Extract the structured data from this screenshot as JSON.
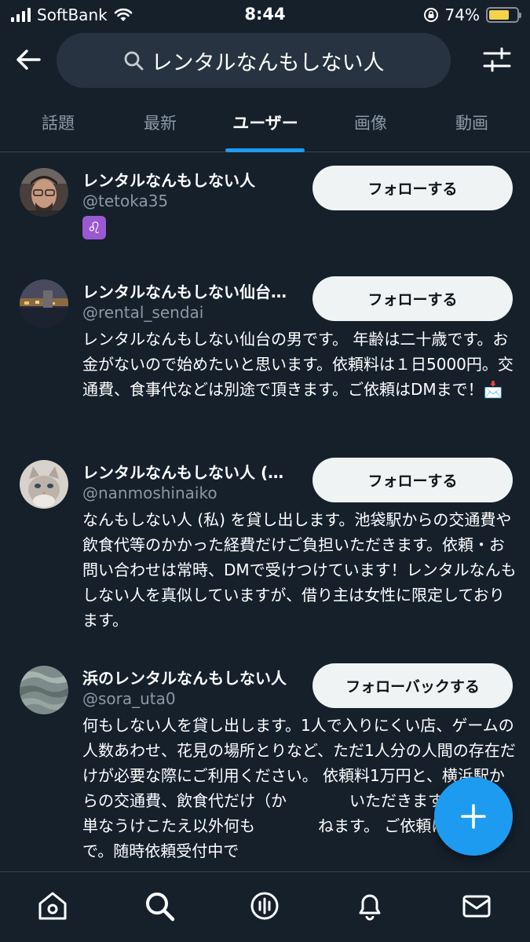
{
  "status_bar": {
    "carrier": "SoftBank",
    "time": "8:44",
    "battery": "74%",
    "battery_level": 0.74
  },
  "search": {
    "query": "レンタルなんもしない人"
  },
  "tabs": [
    {
      "label": "話題"
    },
    {
      "label": "最新"
    },
    {
      "label": "ユーザー"
    },
    {
      "label": "画像"
    },
    {
      "label": "動画"
    }
  ],
  "active_tab": "ユーザー",
  "users": [
    {
      "name": "レンタルなんもしない人",
      "handle": "@tetoka35",
      "bio": "♌",
      "button": "フォローする"
    },
    {
      "name": "レンタルなんもしない仙台…",
      "handle": "@rental_sendai",
      "bio": "レンタルなんもしない仙台の男です。 年齢は二十歳です。お金がないので始めたいと思います。依頼料は１日5000円。交通費、食事代などは別途で頂きます。ご依頼はDMまで！📩",
      "button": "フォローする"
    },
    {
      "name": "レンタルなんもしない人 (…",
      "handle": "@nanmoshinaiko",
      "bio": "なんもしない人 (私) を貸し出します。池袋駅からの交通費や飲食代等のかかった経費だけご負担いただきます。依頼・お問い合わせは常時、DMで受けつけています！レンタルなんもしない人を真似していますが、借り主は女性に限定しております。",
      "button": "フォローする"
    },
    {
      "name": "浜のレンタルなんもしない人",
      "handle": "@sora_uta0",
      "bio": "何もしない人を貸し出します。1人で入りにくい店、ゲームの人数あわせ、花見の場所とりなど、ただ1人分の人間の存在だけが必要な際にご利用ください。 依頼料1万円と、横浜駅からの交通費、飲食代だけ（か　　　　いただきます。ごく簡単なうけこたえ以外何も　　　　ねます。 ご依頼はDMまで。随時依頼受付中で",
      "button": "フォローバックする"
    }
  ],
  "colors": {
    "background": "#15202b",
    "accent": "#1d9bf0",
    "secondary_text": "#8b98a5",
    "button_bg": "#eff3f4"
  },
  "icons": [
    "back-arrow-icon",
    "search-icon",
    "filter-sliders-icon",
    "plus-icon",
    "home-icon",
    "search-icon",
    "spaces-icon",
    "bell-icon",
    "mail-icon"
  ]
}
